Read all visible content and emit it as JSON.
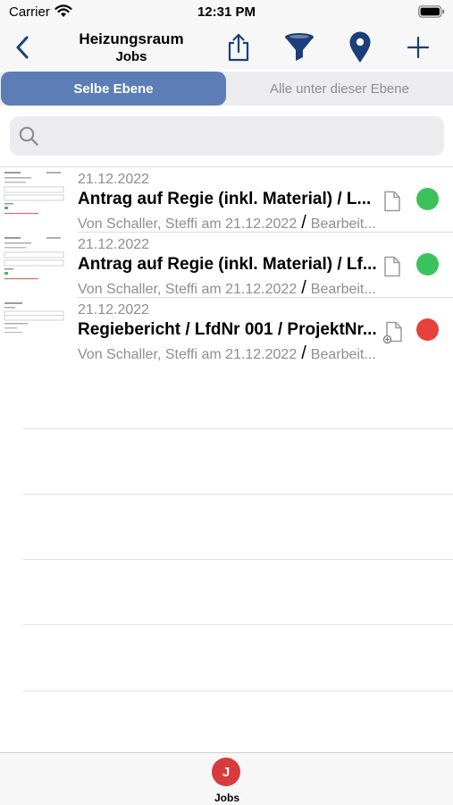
{
  "status_bar": {
    "carrier": "Carrier",
    "time": "12:31 PM"
  },
  "nav": {
    "title": "Heizungsraum",
    "subtitle": "Jobs",
    "accent_color": "#1b3f7a",
    "icons": [
      "back-chevron-icon",
      "share-icon",
      "filter-icon",
      "location-pin-icon",
      "add-icon"
    ]
  },
  "segment": {
    "left_label": "Selbe Ebene",
    "right_label": "Alle unter dieser Ebene",
    "selected": "left",
    "selected_color": "#5c7db6"
  },
  "search": {
    "placeholder": ""
  },
  "jobs": [
    {
      "date": "21.12.2022",
      "title": "Antrag auf Regie (inkl. Material) / L...",
      "author": "Von Schaller, Steffi am 21.12.2022",
      "status_text": "Bearbeit...",
      "status_color": "#3cc25a",
      "doc_icon": "document-icon"
    },
    {
      "date": "21.12.2022",
      "title": "Antrag auf Regie (inkl. Material) / Lf...",
      "author": "Von Schaller, Steffi am 21.12.2022",
      "status_text": "Bearbeit...",
      "status_color": "#3cc25a",
      "doc_icon": "document-icon"
    },
    {
      "date": "21.12.2022",
      "title": "Regiebericht / LfdNr 001 / ProjektNr...",
      "author": "Von Schaller, Steffi am 21.12.2022",
      "status_text": "Bearbeit...",
      "status_color": "#e8403a",
      "doc_icon": "document-add-icon"
    }
  ],
  "tab_bar": {
    "badge_letter": "J",
    "label": "Jobs",
    "badge_color": "#d83b3b"
  }
}
